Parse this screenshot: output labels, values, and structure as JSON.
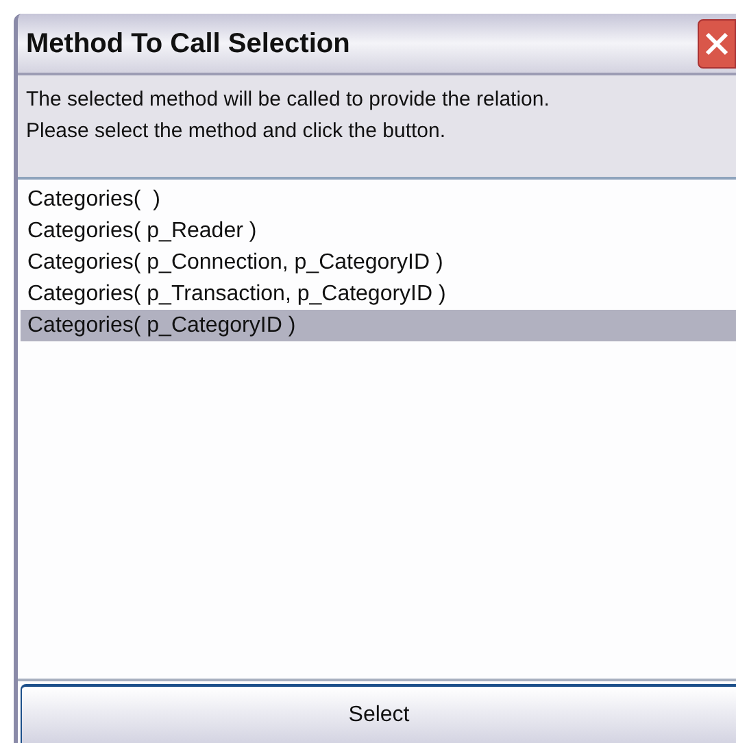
{
  "window": {
    "title": "Method To Call Selection"
  },
  "instructions": [
    "The selected method will be called to provide the relation.",
    "Please select the method and click the button."
  ],
  "methods": [
    {
      "label": "Categories(  )",
      "selected": false
    },
    {
      "label": "Categories( p_Reader )",
      "selected": false
    },
    {
      "label": "Categories( p_Connection, p_CategoryID )",
      "selected": false
    },
    {
      "label": "Categories( p_Transaction, p_CategoryID )",
      "selected": false
    },
    {
      "label": "Categories( p_CategoryID )",
      "selected": true
    }
  ],
  "button": {
    "label": "Select"
  }
}
